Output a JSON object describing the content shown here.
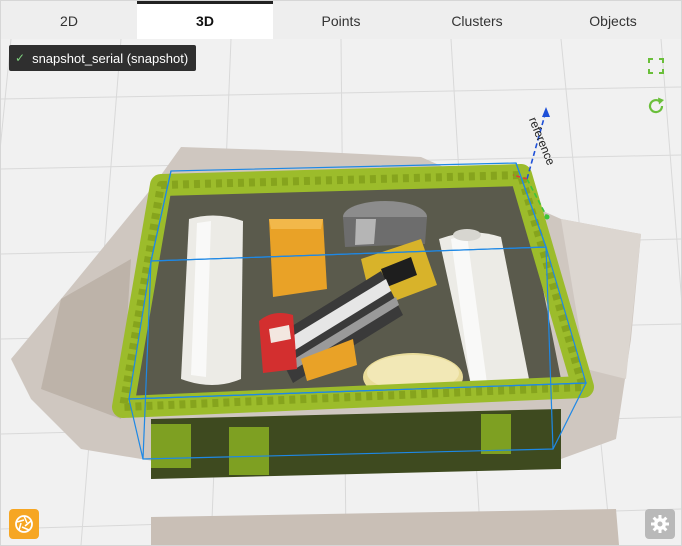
{
  "tabs": [
    {
      "label": "2D",
      "active": false
    },
    {
      "label": "3D",
      "active": true
    },
    {
      "label": "Points",
      "active": false
    },
    {
      "label": "Clusters",
      "active": false
    },
    {
      "label": "Objects",
      "active": false
    }
  ],
  "viewport": {
    "snapshot_chip": {
      "label": "snapshot_serial (snapshot)",
      "icon": "check-icon"
    },
    "reference_frame_label": "reference",
    "icons": {
      "fullscreen": "fullscreen-icon",
      "refresh": "refresh-icon",
      "snapshot": "camera-aperture-icon",
      "settings": "gear-icon"
    }
  },
  "colors": {
    "accent_green": "#6abf3a",
    "snapshot_orange": "#f6a623",
    "bounding_box_blue": "#1e88e5",
    "tray_green": "#9cbc2b"
  }
}
